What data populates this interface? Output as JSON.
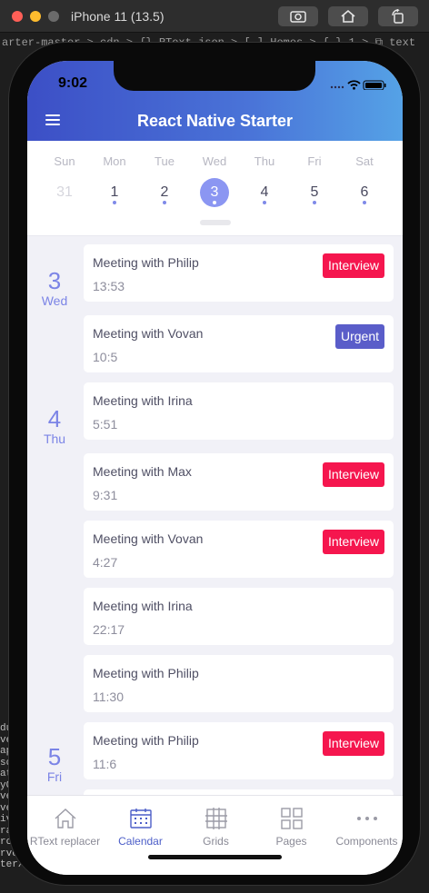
{
  "window": {
    "title": "iPhone 11 (13.5)"
  },
  "editor": {
    "breadcrumb": "arter-master > cdn > {} RText.json > [ ] Homes > { } 1 > ⧉ text",
    "terminal_lines": [
      "du",
      "ve",
      "ap",
      "sc",
      "at",
      "yG",
      "ve",
      "ve",
      "iv",
      "ra",
      "ro",
      "rve",
      "ter/nod"
    ],
    "left_fragments": [
      "es!",
      "\"",
      "\"",
      "UT"
    ]
  },
  "status_bar": {
    "time": "9:02"
  },
  "header": {
    "title": "React Native Starter"
  },
  "week": {
    "days": [
      {
        "name": "Sun",
        "num": "31",
        "state": "past",
        "dot": false
      },
      {
        "name": "Mon",
        "num": "1",
        "state": "normal",
        "dot": true
      },
      {
        "name": "Tue",
        "num": "2",
        "state": "normal",
        "dot": true
      },
      {
        "name": "Wed",
        "num": "3",
        "state": "selected",
        "dot": true
      },
      {
        "name": "Thu",
        "num": "4",
        "state": "normal",
        "dot": true
      },
      {
        "name": "Fri",
        "num": "5",
        "state": "normal",
        "dot": true
      },
      {
        "name": "Sat",
        "num": "6",
        "state": "normal",
        "dot": true
      }
    ]
  },
  "agenda": {
    "day_labels": [
      {
        "num": "3",
        "weekday": "Wed"
      },
      {
        "num": "4",
        "weekday": "Thu"
      },
      {
        "num": "5",
        "weekday": "Fri"
      }
    ],
    "items": [
      {
        "title": "Meeting with Philip",
        "time": "13:53",
        "badge": "Interview"
      },
      {
        "title": "Meeting with Vovan",
        "time": "10:5",
        "badge": "Urgent"
      },
      {
        "title": "Meeting with Irina",
        "time": "5:51",
        "badge": ""
      },
      {
        "title": "Meeting with Max",
        "time": "9:31",
        "badge": "Interview"
      },
      {
        "title": "Meeting with Vovan",
        "time": "4:27",
        "badge": "Interview"
      },
      {
        "title": "Meeting with Irina",
        "time": "22:17",
        "badge": ""
      },
      {
        "title": "Meeting with Philip",
        "time": "11:30",
        "badge": ""
      },
      {
        "title": "Meeting with Philip",
        "time": "11:6",
        "badge": "Interview"
      }
    ],
    "badge_colors": {
      "Interview": "#f5164e",
      "Urgent": "#5a5dc9"
    }
  },
  "tabs": [
    {
      "label": "RText replacer",
      "icon": "home-icon",
      "active": false
    },
    {
      "label": "Calendar",
      "icon": "calendar-icon",
      "active": true
    },
    {
      "label": "Grids",
      "icon": "grid-icon",
      "active": false
    },
    {
      "label": "Pages",
      "icon": "pages-icon",
      "active": false
    },
    {
      "label": "Components",
      "icon": "more-icon",
      "active": false
    }
  ],
  "colors": {
    "accent": "#4c5ec8",
    "header_start": "#3c4fc6",
    "header_end": "#55a2e6",
    "selected_day": "#8b96f2"
  }
}
